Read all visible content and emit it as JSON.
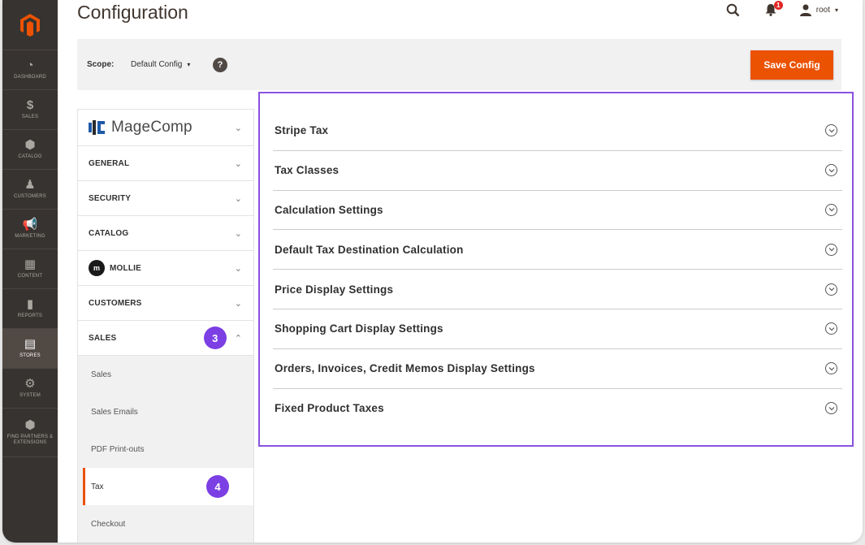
{
  "page": {
    "title": "Configuration"
  },
  "header": {
    "notification_count": "1",
    "user": "root"
  },
  "admin_nav": {
    "items": [
      {
        "label": "DASHBOARD",
        "glyph": "◔",
        "icon": "dashboard-icon"
      },
      {
        "label": "SALES",
        "glyph": "$",
        "icon": "dollar-icon"
      },
      {
        "label": "CATALOG",
        "glyph": "⬢",
        "icon": "cube-icon"
      },
      {
        "label": "CUSTOMERS",
        "glyph": "♟",
        "icon": "person-icon"
      },
      {
        "label": "MARKETING",
        "glyph": "📢",
        "icon": "megaphone-icon"
      },
      {
        "label": "CONTENT",
        "glyph": "▦",
        "icon": "content-icon"
      },
      {
        "label": "REPORTS",
        "glyph": "▮",
        "icon": "bar-chart-icon"
      },
      {
        "label": "STORES",
        "glyph": "▤",
        "icon": "store-icon",
        "active": true
      },
      {
        "label": "SYSTEM",
        "glyph": "⚙",
        "icon": "gear-icon"
      },
      {
        "label": "FIND PARTNERS & EXTENSIONS",
        "glyph": "⬢",
        "icon": "extensions-icon"
      }
    ]
  },
  "scope": {
    "label": "Scope:",
    "value": "Default Config",
    "help": "?"
  },
  "toolbar": {
    "save_label": "Save Config"
  },
  "tabs": {
    "magecomp": "MageComp",
    "general": "GENERAL",
    "security": "SECURITY",
    "catalog": "CATALOG",
    "mollie": "MOLLIE",
    "customers": "CUSTOMERS",
    "sales": "SALES",
    "sales_step": "3",
    "sales_items": [
      "Sales",
      "Sales Emails",
      "PDF Print-outs",
      "Tax",
      "Checkout"
    ],
    "tax_step": "4"
  },
  "sections": [
    "Stripe Tax",
    "Tax Classes",
    "Calculation Settings",
    "Default Tax Destination Calculation",
    "Price Display Settings",
    "Shopping Cart Display Settings",
    "Orders, Invoices, Credit Memos Display Settings",
    "Fixed Product Taxes"
  ],
  "colors": {
    "accent": "#eb5202",
    "highlight": "#8a52e0",
    "nav_bg": "#373330"
  }
}
